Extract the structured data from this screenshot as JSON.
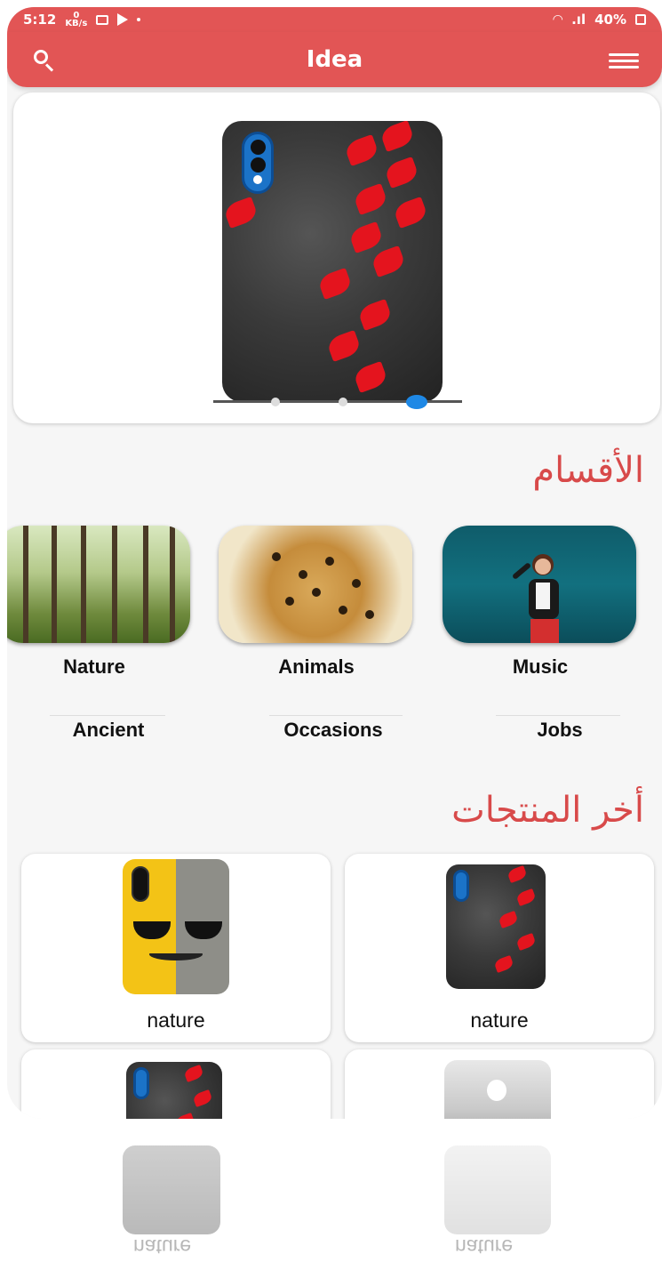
{
  "status_bar": {
    "time": "5:12",
    "net_speed": "0",
    "net_unit": "KB/s",
    "battery": "40%"
  },
  "app_bar": {
    "title": "Idea"
  },
  "banner": {
    "dots": 3,
    "active_dot": 3
  },
  "sections": {
    "categories_title": "الأقسام",
    "latest_title": "أخر المنتجات"
  },
  "categories": [
    {
      "label": "Nature"
    },
    {
      "label": "Animals"
    },
    {
      "label": "Music"
    }
  ],
  "subcategories": [
    {
      "label": "Ancient"
    },
    {
      "label": "Occasions"
    },
    {
      "label": "Jobs"
    }
  ],
  "products": [
    {
      "label": "nature"
    },
    {
      "label": "nature"
    }
  ],
  "reflection_labels": [
    "nature",
    "nature"
  ],
  "colors": {
    "accent": "#e25555",
    "section_title": "#d84a4a",
    "active_dot": "#1e88e5"
  }
}
